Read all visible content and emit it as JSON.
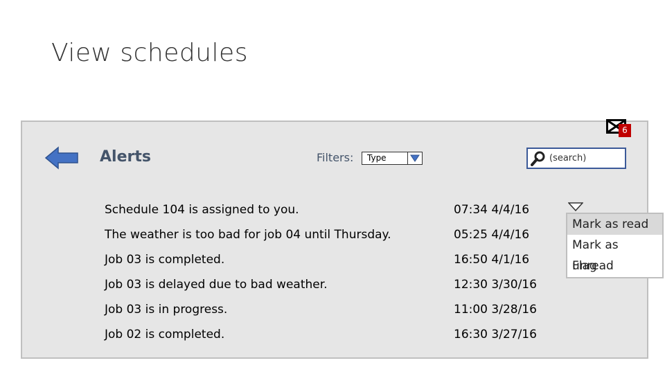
{
  "page": {
    "title": "View schedules"
  },
  "panel": {
    "title": "Alerts",
    "mail_badge": "6",
    "filters_label": "Filters:",
    "filter_select_value": "Type",
    "search_placeholder": "(search)"
  },
  "alerts": [
    {
      "message": "Schedule 104 is assigned to you.",
      "time": "07:34 4/4/16"
    },
    {
      "message": "The weather is too bad for job 04 until Thursday.",
      "time": "05:25 4/4/16"
    },
    {
      "message": "Job 03 is completed.",
      "time": "16:50 4/1/16"
    },
    {
      "message": "Job 03 is delayed due to bad weather.",
      "time": "12:30 3/30/16"
    },
    {
      "message": "Job 03 is in progress.",
      "time": "11:00 3/28/16"
    },
    {
      "message": "Job 02 is completed.",
      "time": "16:30 3/27/16"
    }
  ],
  "context_menu": {
    "items": [
      "Mark as read",
      "Mark as unread",
      "Flag"
    ],
    "highlighted": "Mark as read"
  },
  "colors": {
    "accent_blue": "#4472c4",
    "badge_red": "#c00000",
    "panel_bg": "#e6e6e6",
    "highlight": "#d9d9d9"
  },
  "icons": {
    "back": "back-arrow-icon",
    "mail": "mail-icon",
    "search": "search-icon",
    "dropdown": "chevron-down-icon"
  }
}
